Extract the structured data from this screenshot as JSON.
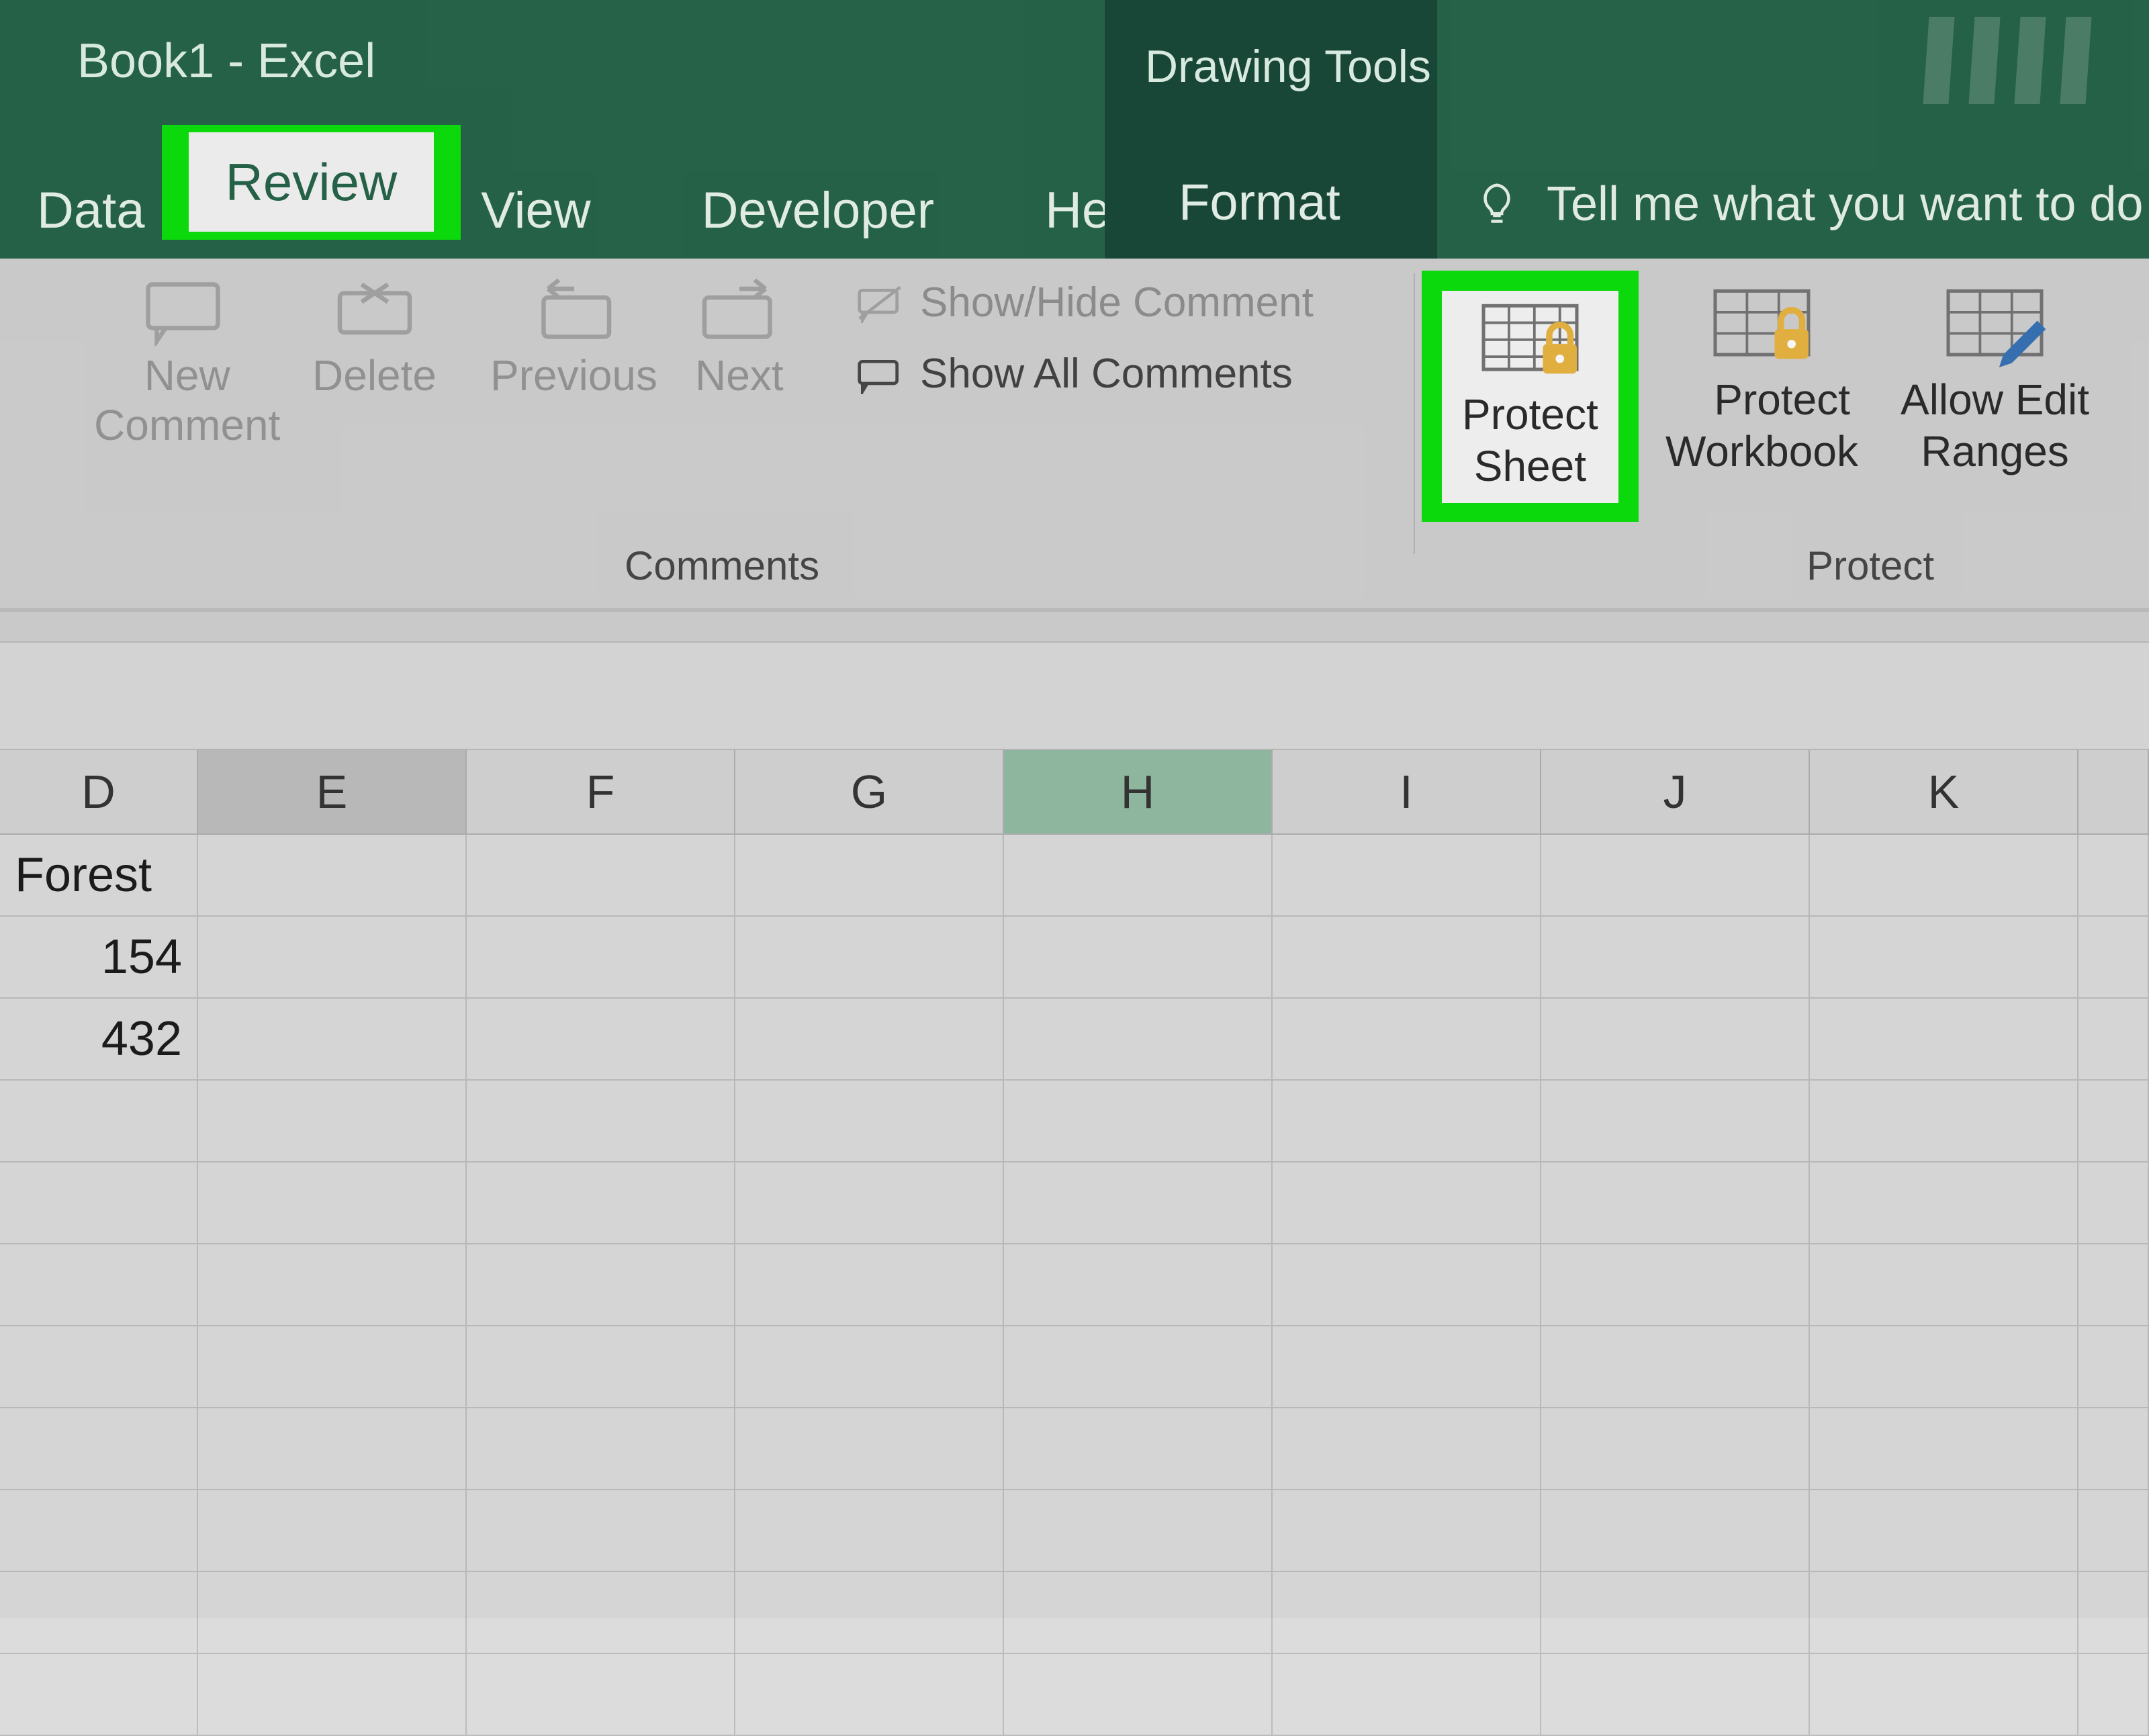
{
  "window": {
    "title": "Book1  -  Excel",
    "context_tool": "Drawing Tools"
  },
  "tabs": {
    "data": "Data",
    "review": "Review",
    "view": "View",
    "developer": "Developer",
    "help": "Help",
    "format": "Format",
    "tell_me": "Tell me what you want to do"
  },
  "ribbon": {
    "comments": {
      "new_comment_line1": "New",
      "new_comment_line2": "Comment",
      "delete": "Delete",
      "previous": "Previous",
      "next": "Next",
      "show_hide": "Show/Hide Comment",
      "show_all": "Show All Comments",
      "group_label": "Comments"
    },
    "protect": {
      "protect_sheet_line1": "Protect",
      "protect_sheet_line2": "Sheet",
      "protect_workbook_line1": "Protect",
      "protect_workbook_line2": "Workbook",
      "allow_edit_line1": "Allow Edit",
      "allow_edit_line2": "Ranges",
      "group_label": "Protect"
    }
  },
  "sheet": {
    "columns": [
      "D",
      "E",
      "F",
      "G",
      "H",
      "I",
      "J",
      "K"
    ],
    "selected_column": "E",
    "active_column": "H",
    "rows": [
      {
        "D": "Forest",
        "E": "",
        "F": "",
        "G": "",
        "H": "",
        "I": "",
        "J": "",
        "K": ""
      },
      {
        "D": "154",
        "E": "",
        "F": "",
        "G": "",
        "H": "",
        "I": "",
        "J": "",
        "K": ""
      },
      {
        "D": "432",
        "E": "",
        "F": "",
        "G": "",
        "H": "",
        "I": "",
        "J": "",
        "K": ""
      }
    ]
  }
}
